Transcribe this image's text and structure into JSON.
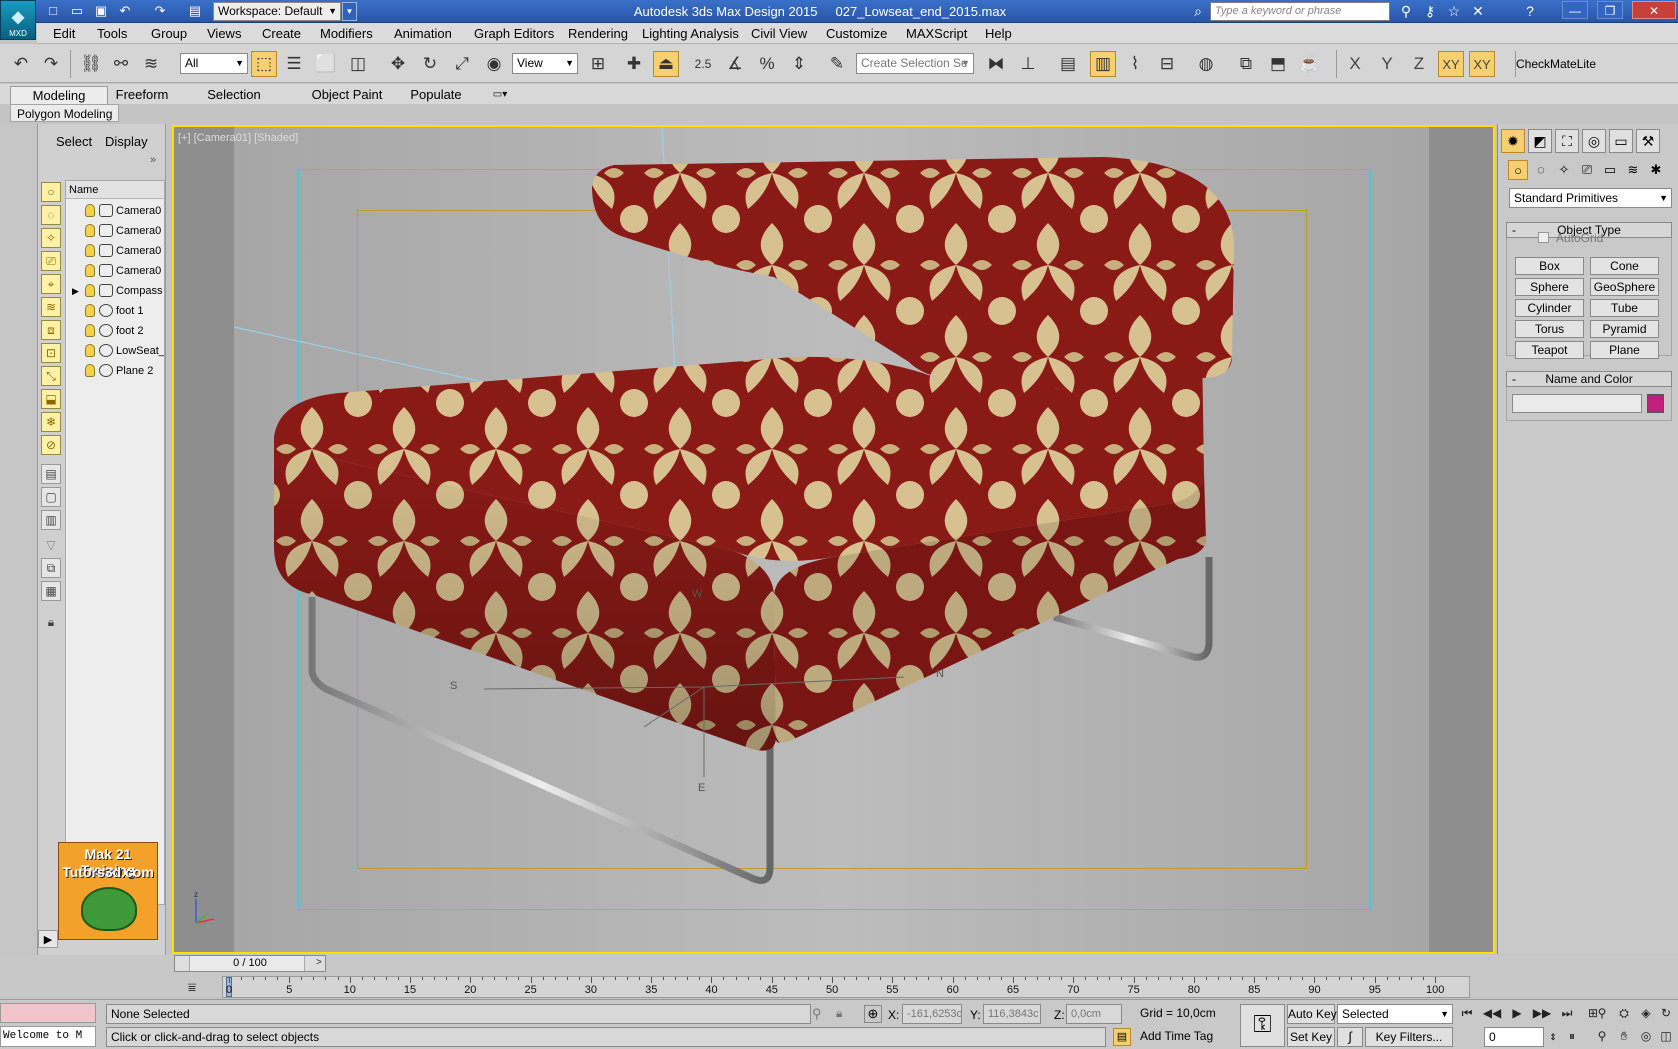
{
  "app": {
    "logo_text": "MXD",
    "window_title": "Autodesk 3ds Max Design 2015",
    "file_name": "027_Lowseat_end_2015.max",
    "workspace": "Workspace: Default",
    "search_placeholder": "Type a keyword or phrase",
    "accent_color": "#2a56a8"
  },
  "menu": [
    "Edit",
    "Tools",
    "Group",
    "Views",
    "Create",
    "Modifiers",
    "Animation",
    "Graph Editors",
    "Rendering",
    "Lighting Analysis",
    "Civil View",
    "Customize",
    "MAXScript",
    "Help"
  ],
  "toolbar": {
    "selection_filter": "All",
    "reference_coord": "View",
    "snap_label": "2.5",
    "angle_snap_label": "%",
    "named_selection_placeholder": "Create Selection Se",
    "axes": [
      "X",
      "Y",
      "Z",
      "XY",
      "XY"
    ],
    "plugin_label": "CheckMateLite"
  },
  "ribbon": {
    "tabs": [
      "Modeling",
      "Freeform",
      "Selection",
      "Object Paint",
      "Populate"
    ],
    "active_tab": "Modeling",
    "subpanel": "Polygon Modeling"
  },
  "explorer": {
    "tabs": [
      "Select",
      "Display"
    ],
    "collapse_glyph": "»",
    "column_header": "Name",
    "items": [
      {
        "name": "Camera0",
        "kind": "camera"
      },
      {
        "name": "Camera0",
        "kind": "camera"
      },
      {
        "name": "Camera0",
        "kind": "camera"
      },
      {
        "name": "Camera0",
        "kind": "camera"
      },
      {
        "name": "Compass",
        "kind": "helper"
      },
      {
        "name": "foot 1",
        "kind": "geometry"
      },
      {
        "name": "foot 2",
        "kind": "geometry"
      },
      {
        "name": "LowSeat_",
        "kind": "geometry"
      },
      {
        "name": "Plane 2",
        "kind": "geometry"
      }
    ],
    "promo_line1": "Mak 21 Training",
    "promo_line2": "Tutors3d.com"
  },
  "viewport": {
    "label": "[+] [Camera01] [Shaded]",
    "compass_labels": [
      "S",
      "N",
      "E",
      "W"
    ],
    "frame_color": "#4ec2dc",
    "safe_frame_color": "#c49a2a",
    "active_border_color": "#ffe000",
    "fabric_red": "#8a1a16",
    "fabric_gold": "#d7c190"
  },
  "timeline": {
    "slider_label": "0 / 100",
    "ticks": [
      0,
      5,
      10,
      15,
      20,
      25,
      30,
      35,
      40,
      45,
      50,
      55,
      60,
      65,
      70,
      75,
      80,
      85,
      90,
      95,
      100
    ],
    "current_frame": 0
  },
  "status": {
    "maxscript_line": "Welcome to M",
    "selection_info": "None Selected",
    "prompt": "Click or click-and-drag to select objects",
    "x_label": "X:",
    "x_value": "-161,6253c",
    "y_label": "Y:",
    "y_value": "116,3843c",
    "z_label": "Z:",
    "z_value": "0,0cm",
    "grid": "Grid = 10,0cm",
    "add_time_tag": "Add Time Tag",
    "auto_key": "Auto Key",
    "set_key": "Set Key",
    "key_mode": "Selected",
    "key_filters": "Key Filters...",
    "frame_field": "0"
  },
  "command_panel": {
    "category": "Standard Primitives",
    "object_type_title": "Object Type",
    "autogrid": "AutoGrid",
    "objects": [
      "Box",
      "Cone",
      "Sphere",
      "GeoSphere",
      "Cylinder",
      "Tube",
      "Torus",
      "Pyramid",
      "Teapot",
      "Plane"
    ],
    "name_color_title": "Name and Color",
    "object_color": "#c0207a"
  }
}
